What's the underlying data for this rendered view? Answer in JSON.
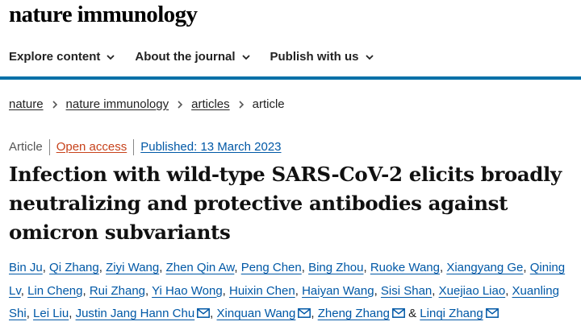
{
  "header": {
    "logo": "nature immunology",
    "nav": [
      {
        "label": "Explore content"
      },
      {
        "label": "About the journal"
      },
      {
        "label": "Publish with us"
      }
    ]
  },
  "breadcrumb": {
    "items": [
      "nature",
      "nature immunology",
      "articles"
    ],
    "current": "article"
  },
  "meta": {
    "type": "Article",
    "open_access": "Open access",
    "published": "Published: 13 March 2023"
  },
  "article": {
    "title": "Infection with wild-type SARS-CoV-2 elicits broadly neutralizing and protective antibodies against omicron subvariants"
  },
  "authors": [
    {
      "name": "Bin Ju",
      "mail": false
    },
    {
      "name": "Qi Zhang",
      "mail": false
    },
    {
      "name": "Ziyi Wang",
      "mail": false
    },
    {
      "name": "Zhen Qin Aw",
      "mail": false
    },
    {
      "name": "Peng Chen",
      "mail": false
    },
    {
      "name": "Bing Zhou",
      "mail": false
    },
    {
      "name": "Ruoke Wang",
      "mail": false
    },
    {
      "name": "Xiangyang Ge",
      "mail": false
    },
    {
      "name": "Qining Lv",
      "mail": false
    },
    {
      "name": "Lin Cheng",
      "mail": false
    },
    {
      "name": "Rui Zhang",
      "mail": false
    },
    {
      "name": "Yi Hao Wong",
      "mail": false
    },
    {
      "name": "Huixin Chen",
      "mail": false
    },
    {
      "name": "Haiyan Wang",
      "mail": false
    },
    {
      "name": "Sisi Shan",
      "mail": false
    },
    {
      "name": "Xuejiao Liao",
      "mail": false
    },
    {
      "name": "Xuanling Shi",
      "mail": false
    },
    {
      "name": "Lei Liu",
      "mail": false
    },
    {
      "name": "Justin Jang Hann Chu",
      "mail": true
    },
    {
      "name": "Xinquan Wang",
      "mail": true
    },
    {
      "name": "Zheng Zhang",
      "mail": true
    },
    {
      "name": "Linqi Zhang",
      "mail": true
    }
  ],
  "icons": {
    "chevron": "chevron-down-icon",
    "breadcrumb_sep": "chevron-right-icon",
    "mail": "envelope-icon"
  },
  "colors": {
    "brand_blue": "#0070a8",
    "link_blue": "#0058a6",
    "open_access": "#c7421b"
  }
}
